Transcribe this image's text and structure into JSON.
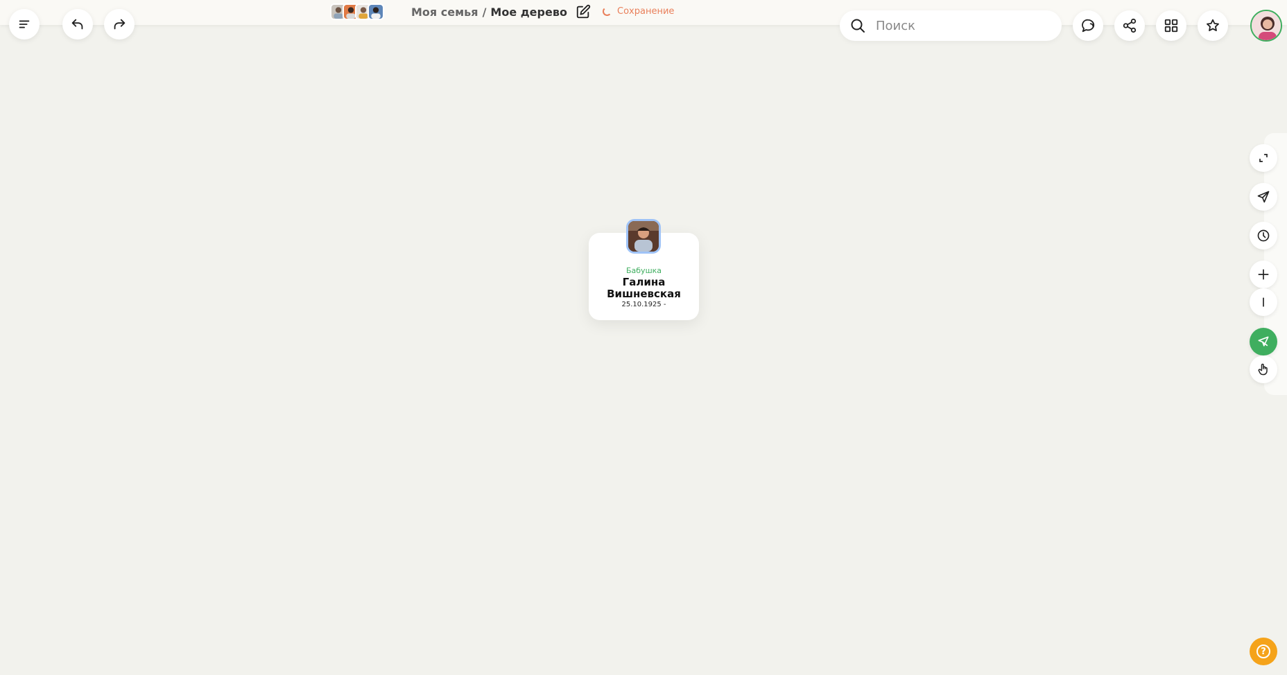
{
  "header": {
    "breadcrumb_family": "Моя семья",
    "breadcrumb_sep": "/",
    "breadcrumb_tree": "Мое дерево",
    "saving_status": "Сохранение"
  },
  "search": {
    "placeholder": "Поиск"
  },
  "toolbar_left": {
    "menu_icon": "menu-icon",
    "undo_icon": "undo-icon",
    "redo_icon": "redo-icon"
  },
  "toolbar_right": {
    "icons": [
      "chat-icon",
      "share-icon",
      "grid-icon",
      "star-icon",
      "profile-avatar"
    ]
  },
  "side_tools": {
    "icons": [
      "fit-screen-icon",
      "send-icon",
      "history-icon",
      "zoom-in-icon",
      "zoom-out-icon",
      "select-cursor-icon",
      "hand-pan-icon"
    ],
    "active": "select-cursor-icon"
  },
  "person_card": {
    "role": "Бабушка",
    "name": "Галина Вишневская",
    "dates": "25.10.1925 -"
  },
  "help": {
    "label": "?"
  },
  "colors": {
    "accent_green": "#3fae5f",
    "saving_orange": "#e97f5a",
    "help_orange": "#f5a31a",
    "canvas_bg": "#f2f2ed"
  }
}
